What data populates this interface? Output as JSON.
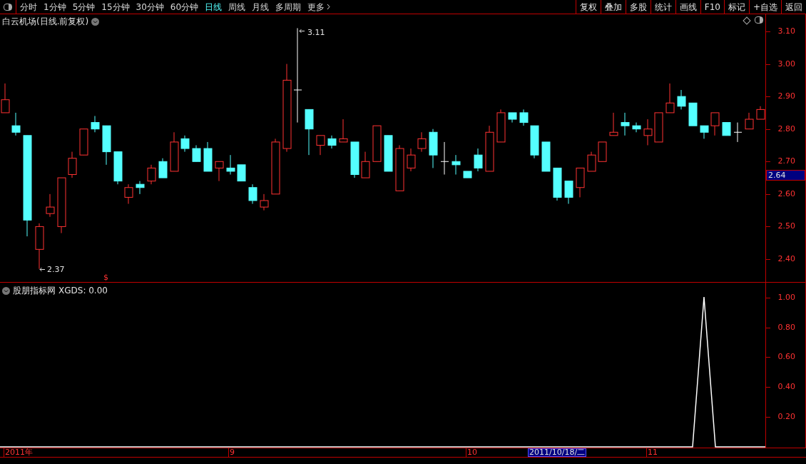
{
  "toolbar": {
    "periods": [
      {
        "label": "分时",
        "selected": false
      },
      {
        "label": "1分钟",
        "selected": false
      },
      {
        "label": "5分钟",
        "selected": false
      },
      {
        "label": "15分钟",
        "selected": false
      },
      {
        "label": "30分钟",
        "selected": false
      },
      {
        "label": "60分钟",
        "selected": false
      },
      {
        "label": "日线",
        "selected": true
      },
      {
        "label": "周线",
        "selected": false
      },
      {
        "label": "月线",
        "selected": false
      },
      {
        "label": "多周期",
        "selected": false
      },
      {
        "label": "更多",
        "selected": false
      }
    ],
    "buttons": [
      "复权",
      "叠加",
      "多股",
      "统计",
      "画线",
      "F10",
      "标记",
      "+自选",
      "返回"
    ]
  },
  "main_chart": {
    "title": "白云机场(日线.前复权)",
    "price_labels": [
      "3.10",
      "3.00",
      "2.90",
      "2.80",
      "2.70",
      "2.60",
      "2.50",
      "2.40"
    ],
    "current_price": "2.64",
    "high_marker": "3.11",
    "low_marker": "2.37",
    "signal_marker": "$"
  },
  "indicator": {
    "title": "股朋指标网",
    "reading": "XGDS: 0.00",
    "axis_labels": [
      "1.00",
      "0.80",
      "0.60",
      "0.40",
      "0.20"
    ]
  },
  "date_axis": {
    "labels": [
      "2011年",
      "9",
      "10",
      "11"
    ],
    "cursor_date": "2011/10/18/二"
  }
}
